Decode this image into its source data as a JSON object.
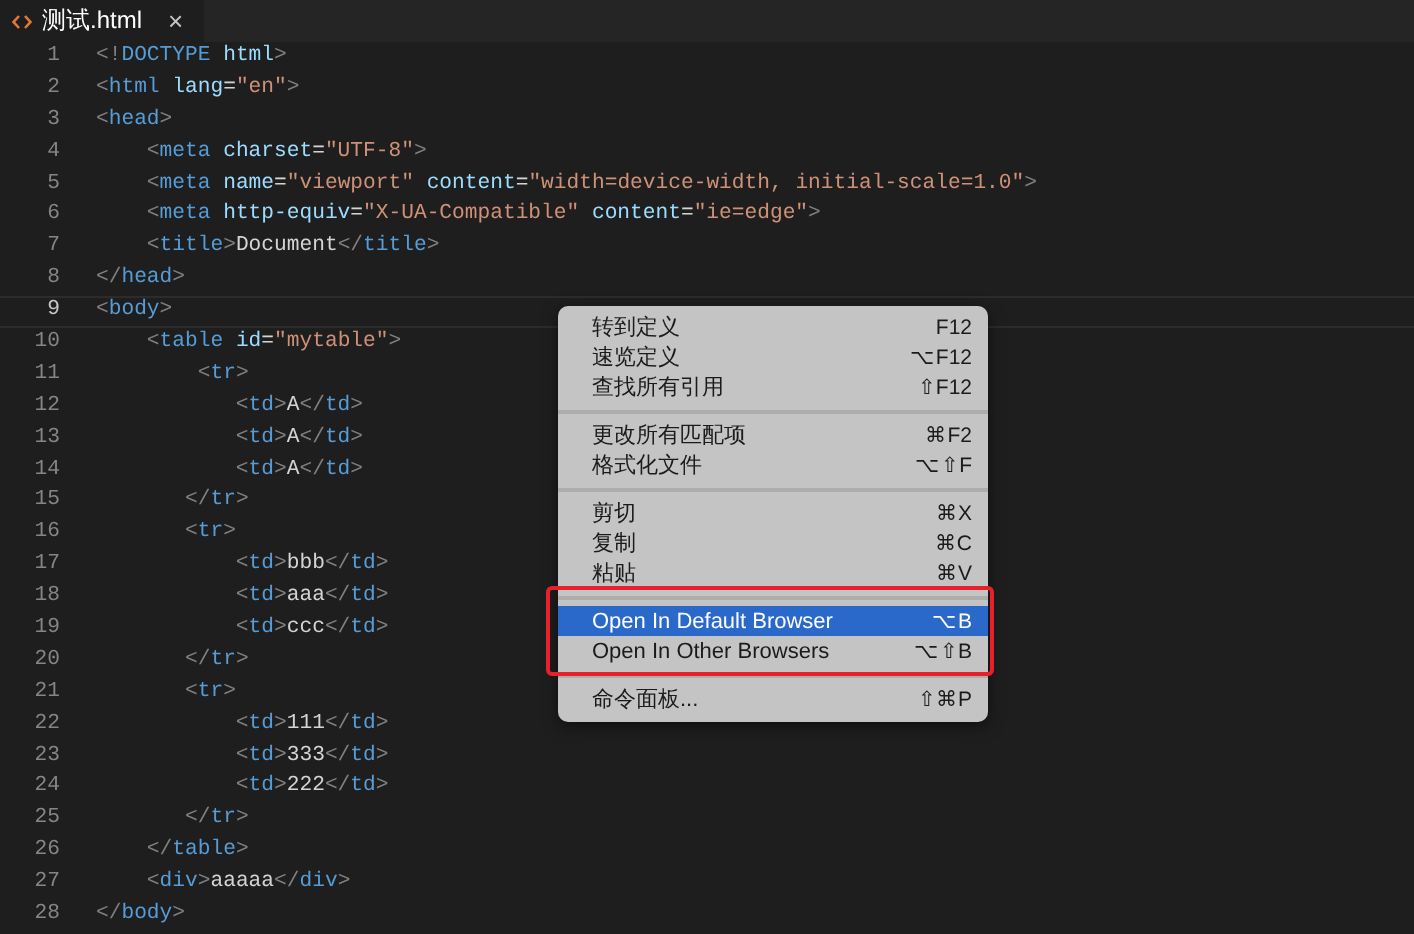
{
  "tabs": [
    {
      "title": "测试.html",
      "close": "×",
      "selected": true
    }
  ],
  "editor": {
    "lines": [
      {
        "number": "1",
        "current": false,
        "tokens": [
          {
            "kind": "punct",
            "text": "<!"
          },
          {
            "kind": "tag",
            "text": "DOCTYPE"
          },
          {
            "kind": "attr",
            "text": " html"
          },
          {
            "kind": "punct",
            "text": ">"
          }
        ]
      },
      {
        "number": "2",
        "current": false,
        "tokens": [
          {
            "kind": "punct",
            "text": "<"
          },
          {
            "kind": "tag",
            "text": "html"
          },
          {
            "kind": "attr",
            "text": " lang"
          },
          {
            "kind": "text",
            "text": "="
          },
          {
            "kind": "string",
            "text": "\"en\""
          },
          {
            "kind": "punct",
            "text": ">"
          }
        ]
      },
      {
        "number": "3",
        "current": false,
        "tokens": [
          {
            "kind": "punct",
            "text": "<"
          },
          {
            "kind": "tag",
            "text": "head"
          },
          {
            "kind": "punct",
            "text": ">"
          }
        ]
      },
      {
        "number": "4",
        "current": false,
        "tokens": [
          {
            "kind": "punct",
            "text": "    <"
          },
          {
            "kind": "tag",
            "text": "meta"
          },
          {
            "kind": "attr",
            "text": " charset"
          },
          {
            "kind": "text",
            "text": "="
          },
          {
            "kind": "string",
            "text": "\"UTF-8\""
          },
          {
            "kind": "punct",
            "text": ">"
          }
        ]
      },
      {
        "number": "5",
        "current": false,
        "tokens": [
          {
            "kind": "punct",
            "text": "    <"
          },
          {
            "kind": "tag",
            "text": "meta"
          },
          {
            "kind": "attr",
            "text": " name"
          },
          {
            "kind": "text",
            "text": "="
          },
          {
            "kind": "string",
            "text": "\"viewport\""
          },
          {
            "kind": "attr",
            "text": " content"
          },
          {
            "kind": "text",
            "text": "="
          },
          {
            "kind": "string",
            "text": "\"width=device-width, initial-scale=1.0\""
          },
          {
            "kind": "punct",
            "text": ">"
          }
        ]
      },
      {
        "number": "6",
        "current": false,
        "tokens": [
          {
            "kind": "punct",
            "text": "    <"
          },
          {
            "kind": "tag",
            "text": "meta"
          },
          {
            "kind": "attr",
            "text": " http-equiv"
          },
          {
            "kind": "text",
            "text": "="
          },
          {
            "kind": "string",
            "text": "\"X-UA-Compatible\""
          },
          {
            "kind": "attr",
            "text": " content"
          },
          {
            "kind": "text",
            "text": "="
          },
          {
            "kind": "string",
            "text": "\"ie=edge\""
          },
          {
            "kind": "punct",
            "text": ">"
          }
        ]
      },
      {
        "number": "7",
        "current": false,
        "tokens": [
          {
            "kind": "punct",
            "text": "    <"
          },
          {
            "kind": "tag",
            "text": "title"
          },
          {
            "kind": "punct",
            "text": ">"
          },
          {
            "kind": "text",
            "text": "Document"
          },
          {
            "kind": "punct",
            "text": "</"
          },
          {
            "kind": "tag",
            "text": "title"
          },
          {
            "kind": "punct",
            "text": ">"
          }
        ]
      },
      {
        "number": "8",
        "current": false,
        "tokens": [
          {
            "kind": "punct",
            "text": "</"
          },
          {
            "kind": "tag",
            "text": "head"
          },
          {
            "kind": "punct",
            "text": ">"
          }
        ]
      },
      {
        "number": "9",
        "current": true,
        "tokens": [
          {
            "kind": "punct",
            "text": "<"
          },
          {
            "kind": "tag",
            "text": "body"
          },
          {
            "kind": "punct",
            "text": ">"
          }
        ]
      },
      {
        "number": "10",
        "current": false,
        "tokens": [
          {
            "kind": "punct",
            "text": "    <"
          },
          {
            "kind": "tag",
            "text": "table"
          },
          {
            "kind": "attr",
            "text": " id"
          },
          {
            "kind": "text",
            "text": "="
          },
          {
            "kind": "string",
            "text": "\"mytable\""
          },
          {
            "kind": "punct",
            "text": ">"
          }
        ]
      },
      {
        "number": "11",
        "current": false,
        "tokens": [
          {
            "kind": "punct",
            "text": "        <"
          },
          {
            "kind": "tag",
            "text": "tr"
          },
          {
            "kind": "punct",
            "text": ">"
          }
        ]
      },
      {
        "number": "12",
        "current": false,
        "tokens": [
          {
            "kind": "punct",
            "text": "           <"
          },
          {
            "kind": "tag",
            "text": "td"
          },
          {
            "kind": "punct",
            "text": ">"
          },
          {
            "kind": "text",
            "text": "A"
          },
          {
            "kind": "punct",
            "text": "</"
          },
          {
            "kind": "tag",
            "text": "td"
          },
          {
            "kind": "punct",
            "text": ">"
          }
        ]
      },
      {
        "number": "13",
        "current": false,
        "tokens": [
          {
            "kind": "punct",
            "text": "           <"
          },
          {
            "kind": "tag",
            "text": "td"
          },
          {
            "kind": "punct",
            "text": ">"
          },
          {
            "kind": "text",
            "text": "A"
          },
          {
            "kind": "punct",
            "text": "</"
          },
          {
            "kind": "tag",
            "text": "td"
          },
          {
            "kind": "punct",
            "text": ">"
          }
        ]
      },
      {
        "number": "14",
        "current": false,
        "tokens": [
          {
            "kind": "punct",
            "text": "           <"
          },
          {
            "kind": "tag",
            "text": "td"
          },
          {
            "kind": "punct",
            "text": ">"
          },
          {
            "kind": "text",
            "text": "A"
          },
          {
            "kind": "punct",
            "text": "</"
          },
          {
            "kind": "tag",
            "text": "td"
          },
          {
            "kind": "punct",
            "text": ">"
          }
        ]
      },
      {
        "number": "15",
        "current": false,
        "tokens": [
          {
            "kind": "punct",
            "text": "       </"
          },
          {
            "kind": "tag",
            "text": "tr"
          },
          {
            "kind": "punct",
            "text": ">"
          }
        ]
      },
      {
        "number": "16",
        "current": false,
        "tokens": [
          {
            "kind": "punct",
            "text": "       <"
          },
          {
            "kind": "tag",
            "text": "tr"
          },
          {
            "kind": "punct",
            "text": ">"
          }
        ]
      },
      {
        "number": "17",
        "current": false,
        "tokens": [
          {
            "kind": "punct",
            "text": "           <"
          },
          {
            "kind": "tag",
            "text": "td"
          },
          {
            "kind": "punct",
            "text": ">"
          },
          {
            "kind": "text",
            "text": "bbb"
          },
          {
            "kind": "punct",
            "text": "</"
          },
          {
            "kind": "tag",
            "text": "td"
          },
          {
            "kind": "punct",
            "text": ">"
          }
        ]
      },
      {
        "number": "18",
        "current": false,
        "tokens": [
          {
            "kind": "punct",
            "text": "           <"
          },
          {
            "kind": "tag",
            "text": "td"
          },
          {
            "kind": "punct",
            "text": ">"
          },
          {
            "kind": "text",
            "text": "aaa"
          },
          {
            "kind": "punct",
            "text": "</"
          },
          {
            "kind": "tag",
            "text": "td"
          },
          {
            "kind": "punct",
            "text": ">"
          }
        ]
      },
      {
        "number": "19",
        "current": false,
        "tokens": [
          {
            "kind": "punct",
            "text": "           <"
          },
          {
            "kind": "tag",
            "text": "td"
          },
          {
            "kind": "punct",
            "text": ">"
          },
          {
            "kind": "text",
            "text": "ccc"
          },
          {
            "kind": "punct",
            "text": "</"
          },
          {
            "kind": "tag",
            "text": "td"
          },
          {
            "kind": "punct",
            "text": ">"
          }
        ]
      },
      {
        "number": "20",
        "current": false,
        "tokens": [
          {
            "kind": "punct",
            "text": "       </"
          },
          {
            "kind": "tag",
            "text": "tr"
          },
          {
            "kind": "punct",
            "text": ">"
          }
        ]
      },
      {
        "number": "21",
        "current": false,
        "tokens": [
          {
            "kind": "punct",
            "text": "       <"
          },
          {
            "kind": "tag",
            "text": "tr"
          },
          {
            "kind": "punct",
            "text": ">"
          }
        ]
      },
      {
        "number": "22",
        "current": false,
        "tokens": [
          {
            "kind": "punct",
            "text": "           <"
          },
          {
            "kind": "tag",
            "text": "td"
          },
          {
            "kind": "punct",
            "text": ">"
          },
          {
            "kind": "text",
            "text": "111"
          },
          {
            "kind": "punct",
            "text": "</"
          },
          {
            "kind": "tag",
            "text": "td"
          },
          {
            "kind": "punct",
            "text": ">"
          }
        ]
      },
      {
        "number": "23",
        "current": false,
        "tokens": [
          {
            "kind": "punct",
            "text": "           <"
          },
          {
            "kind": "tag",
            "text": "td"
          },
          {
            "kind": "punct",
            "text": ">"
          },
          {
            "kind": "text",
            "text": "333"
          },
          {
            "kind": "punct",
            "text": "</"
          },
          {
            "kind": "tag",
            "text": "td"
          },
          {
            "kind": "punct",
            "text": ">"
          }
        ]
      },
      {
        "number": "24",
        "current": false,
        "tokens": [
          {
            "kind": "punct",
            "text": "           <"
          },
          {
            "kind": "tag",
            "text": "td"
          },
          {
            "kind": "punct",
            "text": ">"
          },
          {
            "kind": "text",
            "text": "222"
          },
          {
            "kind": "punct",
            "text": "</"
          },
          {
            "kind": "tag",
            "text": "td"
          },
          {
            "kind": "punct",
            "text": ">"
          }
        ]
      },
      {
        "number": "25",
        "current": false,
        "tokens": [
          {
            "kind": "punct",
            "text": "       </"
          },
          {
            "kind": "tag",
            "text": "tr"
          },
          {
            "kind": "punct",
            "text": ">"
          }
        ]
      },
      {
        "number": "26",
        "current": false,
        "tokens": [
          {
            "kind": "punct",
            "text": "    </"
          },
          {
            "kind": "tag",
            "text": "table"
          },
          {
            "kind": "punct",
            "text": ">"
          }
        ]
      },
      {
        "number": "27",
        "current": false,
        "tokens": [
          {
            "kind": "punct",
            "text": "    <"
          },
          {
            "kind": "tag",
            "text": "div"
          },
          {
            "kind": "punct",
            "text": ">"
          },
          {
            "kind": "text",
            "text": "aaaaa"
          },
          {
            "kind": "punct",
            "text": "</"
          },
          {
            "kind": "tag",
            "text": "div"
          },
          {
            "kind": "punct",
            "text": ">"
          }
        ]
      },
      {
        "number": "28",
        "current": false,
        "tokens": [
          {
            "kind": "punct",
            "text": "</"
          },
          {
            "kind": "tag",
            "text": "body"
          },
          {
            "kind": "punct",
            "text": ">"
          }
        ]
      }
    ]
  },
  "context_menu": {
    "groups": [
      {
        "framed": false,
        "items": [
          {
            "label": "转到定义",
            "shortcut": "F12",
            "selected": false
          },
          {
            "label": "速览定义",
            "shortcut": "⌥F12",
            "selected": false
          },
          {
            "label": "查找所有引用",
            "shortcut": "⇧F12",
            "selected": false
          }
        ]
      },
      {
        "framed": false,
        "items": [
          {
            "label": "更改所有匹配项",
            "shortcut": "⌘F2",
            "selected": false
          },
          {
            "label": "格式化文件",
            "shortcut": "⌥⇧F",
            "selected": false
          }
        ]
      },
      {
        "framed": false,
        "items": [
          {
            "label": "剪切",
            "shortcut": "⌘X",
            "selected": false
          },
          {
            "label": "复制",
            "shortcut": "⌘C",
            "selected": false
          },
          {
            "label": "粘贴",
            "shortcut": "⌘V",
            "selected": false
          }
        ]
      },
      {
        "framed": true,
        "items": [
          {
            "label": "Open In Default Browser",
            "shortcut": "⌥B",
            "selected": true
          },
          {
            "label": "Open In Other Browsers",
            "shortcut": "⌥⇧B",
            "selected": false
          }
        ]
      },
      {
        "framed": false,
        "items": [
          {
            "label": "命令面板...",
            "shortcut": "⇧⌘P",
            "selected": false
          }
        ]
      }
    ]
  }
}
